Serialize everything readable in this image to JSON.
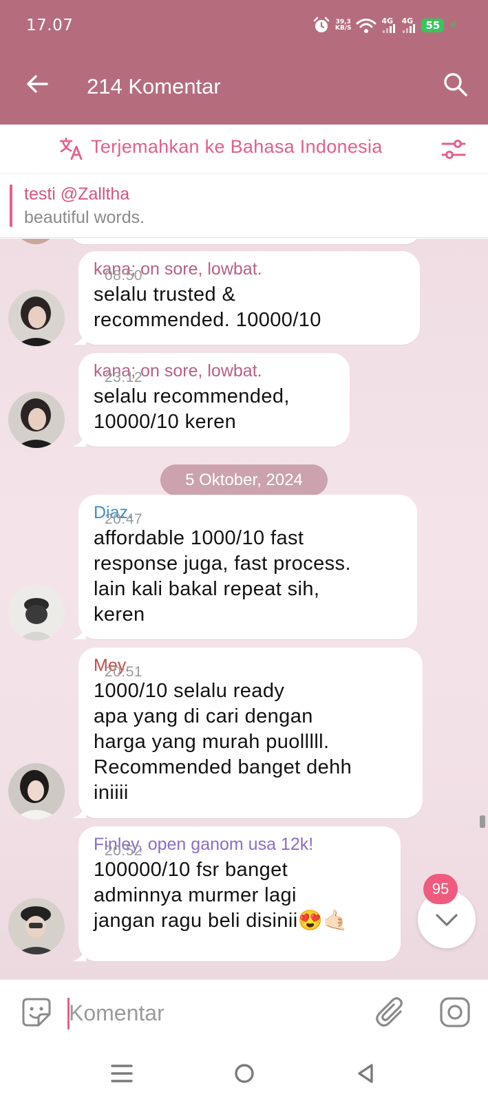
{
  "status": {
    "time": "17.07",
    "speed_top": "39,3",
    "speed_unit": "KB/S",
    "net1": "4G",
    "net2": "4G",
    "battery": "55"
  },
  "header": {
    "title": "214 Komentar"
  },
  "translate": {
    "label": "Terjemahkan ke Bahasa Indonesia"
  },
  "pinned": {
    "title": "testi @Zalltha",
    "text": "beautiful words."
  },
  "messages": [
    {
      "name": "kana; on sore, lowbat.",
      "name_color": "#b85f86",
      "text": "selalu trusted &\nrecommended. 10000/10",
      "time": "08:50"
    },
    {
      "name": "kana; on sore, lowbat.",
      "name_color": "#b85f86",
      "text": "selalu recommended,\n10000/10 keren",
      "time": "23:12"
    },
    {
      "name": "Diaz.",
      "name_color": "#3b8fd0",
      "text": "affordable 1000/10 fast\nresponse juga, fast process.\nlain kali bakal repeat sih,\nkeren",
      "time": "20:47"
    },
    {
      "name": "Mey.",
      "name_color": "#c44a45",
      "text": "1000/10 selalu ready\napa yang di cari dengan\nharga yang murah puolllll.\nRecommended banget dehh\niniiii",
      "time": "20:51"
    },
    {
      "name": "Finley, open ganom usa 12k!",
      "name_color": "#8a6cc9",
      "text": "100000/10 fsr banget\nadminnya murmer lagi\njangan ragu beli disinii😍🤙🏻",
      "time": "20:52"
    }
  ],
  "date_chip": "5 Oktober, 2024",
  "unread_badge": "95",
  "composer": {
    "placeholder": "Komentar"
  },
  "colors": {
    "header": "#b56d7e",
    "accent": "#e55d8c"
  }
}
